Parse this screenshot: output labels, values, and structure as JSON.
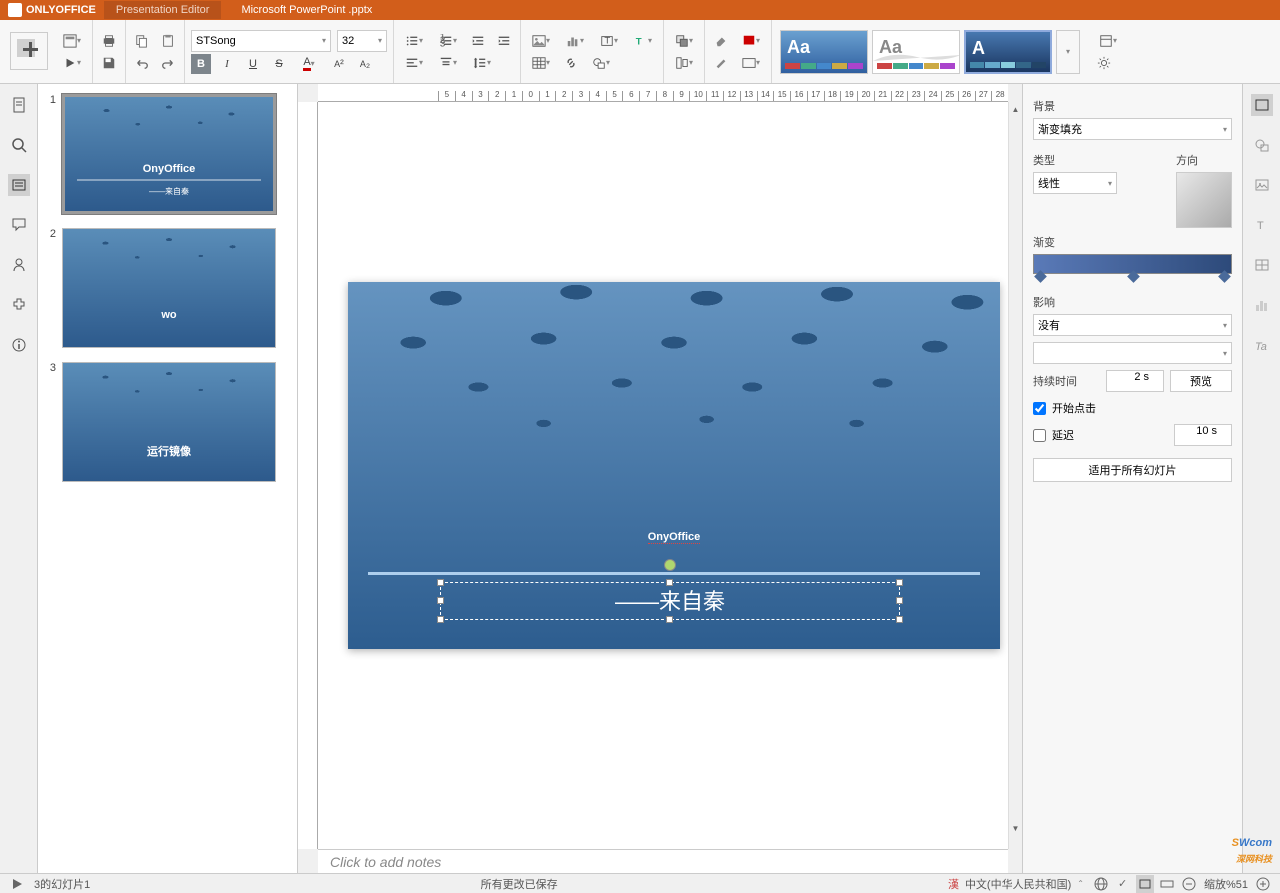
{
  "app": {
    "brand": "ONLYOFFICE",
    "editor": "Presentation Editor",
    "document": "Microsoft PowerPoint .pptx"
  },
  "toolbar": {
    "font": "STSong",
    "size": "32"
  },
  "thumbs": [
    {
      "num": "1",
      "title": "OnyOffice",
      "sub": "——来自秦"
    },
    {
      "num": "2",
      "title": "wo",
      "sub": ""
    },
    {
      "num": "3",
      "title": "运行镜像",
      "sub": ""
    }
  ],
  "slide": {
    "title": "OnyOffice",
    "subtitle": "——来自秦"
  },
  "notes": {
    "placeholder": "Click to add notes"
  },
  "panel": {
    "background_label": "背景",
    "background_value": "渐变填充",
    "type_label": "类型",
    "type_value": "线性",
    "direction_label": "方向",
    "gradient_label": "渐变",
    "effect_label": "影响",
    "effect_value": "没有",
    "duration_label": "持续时间",
    "duration_value": "2 s",
    "preview_btn": "预览",
    "start_click": "开始点击",
    "delay_label": "延迟",
    "delay_value": "10 s",
    "apply_all": "适用于所有幻灯片"
  },
  "status": {
    "slide_info": "3的幻灯片1",
    "save_state": "所有更改已保存",
    "language": "中文(中华人民共和国)",
    "zoom": "缩放%51"
  },
  "ruler_h": [
    "5",
    "4",
    "3",
    "2",
    "1",
    "0",
    "1",
    "2",
    "3",
    "4",
    "5",
    "6",
    "7",
    "8",
    "9",
    "10",
    "11",
    "12",
    "13",
    "14",
    "15",
    "16",
    "17",
    "18",
    "19",
    "20",
    "21",
    "22",
    "23",
    "24",
    "25",
    "26",
    "27",
    "28"
  ]
}
